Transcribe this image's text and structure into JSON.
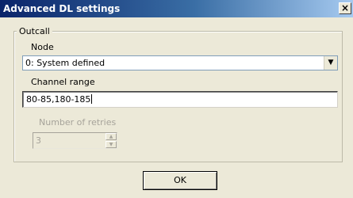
{
  "window": {
    "title": "Advanced DL settings",
    "close_glyph": "×"
  },
  "outcall": {
    "group_label": "Outcall",
    "node_label": "Node",
    "node_value": "0: System defined",
    "dropdown_glyph": "▼",
    "channel_range_label": "Channel range",
    "channel_range_value": "80-85,180-185",
    "retries_label": "Number of retries",
    "retries_value": "3",
    "retries_enabled": false,
    "spin_up_glyph": "▲",
    "spin_down_glyph": "▼"
  },
  "buttons": {
    "ok_label": "OK"
  },
  "colors": {
    "titlebar_start": "#0a246a",
    "titlebar_end": "#a6caf0",
    "dialog_bg": "#ece9d8",
    "disabled_text": "#a6a39a"
  },
  "icons": [
    "close-icon",
    "dropdown-arrow-icon",
    "spin-up-icon",
    "spin-down-icon"
  ]
}
